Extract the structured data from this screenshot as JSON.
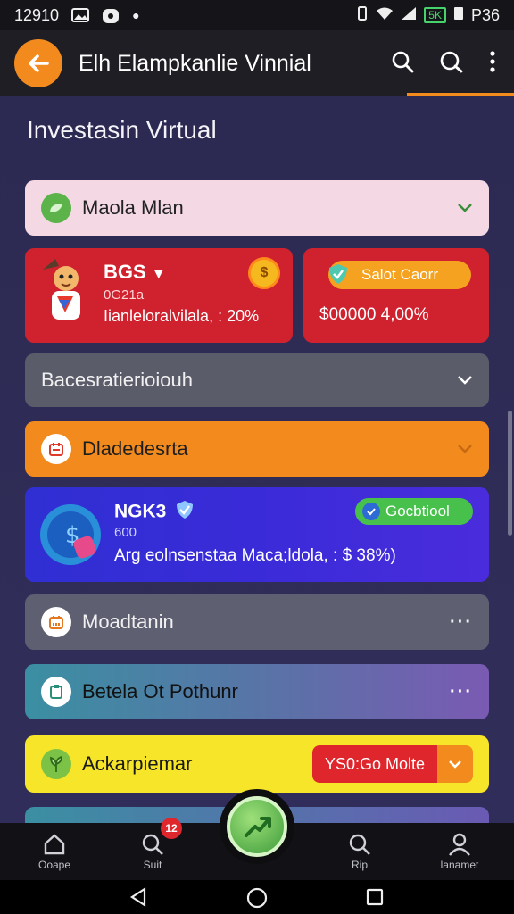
{
  "status": {
    "time": "12910",
    "right_text": "P36",
    "battery": "5K"
  },
  "appbar": {
    "title": "Elh Elampkanlie Vinnial"
  },
  "section": {
    "title": "Investasin Virtual"
  },
  "rows": {
    "r1": {
      "label": "Maola Mlan"
    },
    "r2": {
      "label": "Bacesratierioiouh"
    },
    "r3": {
      "label": "Dladedesrta"
    },
    "r4": {
      "label": "Moadtanin"
    },
    "r5": {
      "label": "Betela Ot Pothunr"
    },
    "r6": {
      "label": "Ackarpiemar",
      "pill": "YS0:Go Molte"
    }
  },
  "card_left": {
    "title": "BGS",
    "sub": "0G21a",
    "stat": "Iianleloralvilala, : 20%"
  },
  "card_right": {
    "pill": "Salot Caorr",
    "value": "$00000 4,00%"
  },
  "card_featured": {
    "title": "NGK3",
    "sub": "600",
    "desc": "Arg eolnsenstaa Maca;ldola, : $ 38%)",
    "pill": "Gocbtiool"
  },
  "nav": {
    "home": "Ooape",
    "search": "Suit",
    "search_badge": "12",
    "tip": "Rip",
    "profile": "lanamet"
  },
  "colors": {
    "accent": "#f28a1e",
    "red": "#d0222e",
    "green": "#47c14c",
    "purple": "#3a2bd8"
  }
}
